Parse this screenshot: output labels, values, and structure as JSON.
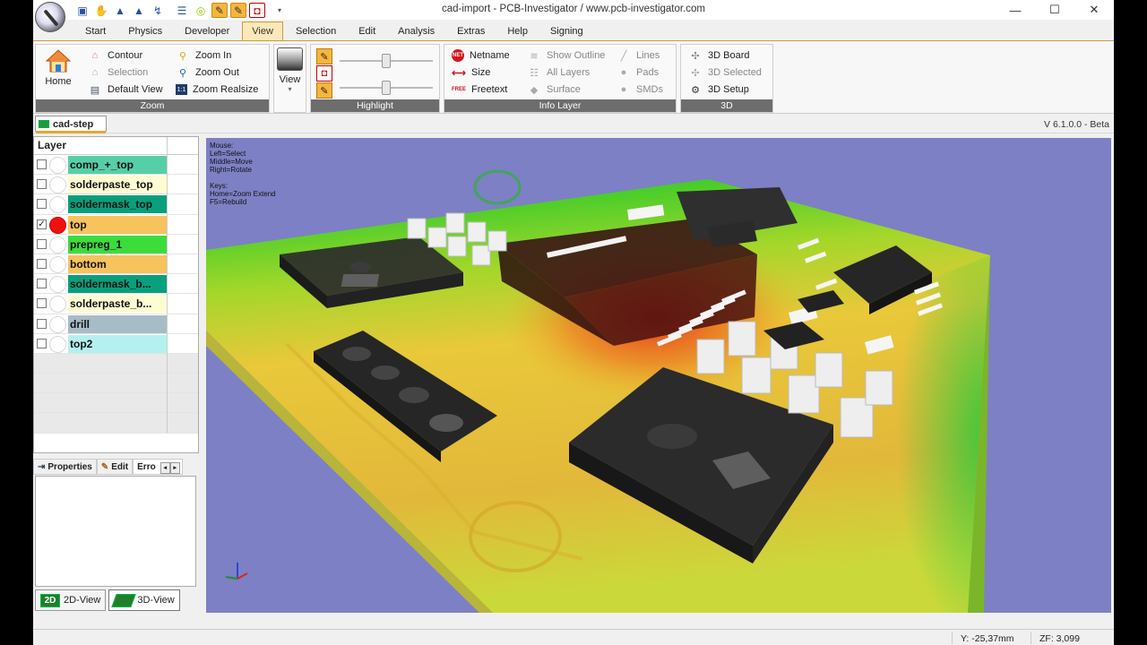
{
  "window": {
    "title": "cad-import - PCB-Investigator  /  www.pcb-investigator.com",
    "controls": [
      "—",
      "☐",
      "✕"
    ]
  },
  "quick_access": {
    "buttons": [
      "save-icon",
      "hand-icon",
      "tree-icon",
      "tree-select-icon",
      "route-icon",
      "layer-stack-icon",
      "circle-icon",
      "highlight-icon",
      "highlight2-icon",
      "frame-icon"
    ],
    "dropdown": "▾"
  },
  "tabs": [
    "Start",
    "Physics",
    "Developer",
    "View",
    "Selection",
    "Edit",
    "Analysis",
    "Extras",
    "Help",
    "Signing"
  ],
  "active_tab": "View",
  "ribbon": {
    "zoom": {
      "label": "Zoom",
      "home": "Home",
      "contour": "Contour",
      "selection": "Selection",
      "default_view": "Default View",
      "zoom_in": "Zoom In",
      "zoom_out": "Zoom Out",
      "zoom_realsize": "Zoom Realsize"
    },
    "view": {
      "label": "View",
      "dropdown": "▾"
    },
    "highlight": {
      "label": "Highlight",
      "slider1": 0.5,
      "slider2": 0.5
    },
    "info_layer": {
      "label": "Info Layer",
      "netname": "Netname",
      "size": "Size",
      "freetext": "Freetext",
      "show_outline": "Show Outline",
      "all_layers": "All Layers",
      "surface": "Surface",
      "lines": "Lines",
      "pads": "Pads",
      "smds": "SMDs",
      "net_badge": "NET",
      "freetext_badge": "FREE"
    },
    "three_d": {
      "label": "3D",
      "board": "3D Board",
      "selected": "3D Selected",
      "setup": "3D Setup"
    }
  },
  "document": {
    "tab": "cad-step",
    "version": "V 6.1.0.0 - Beta"
  },
  "layers": {
    "header": "Layer",
    "items": [
      {
        "name": "comp_+_top",
        "color": "#56cfa8",
        "checked": false,
        "active": false
      },
      {
        "name": "solderpaste_top",
        "color": "#fffbd2",
        "checked": false,
        "active": false
      },
      {
        "name": "soldermask_top",
        "color": "#08a07c",
        "checked": false,
        "active": false
      },
      {
        "name": "top",
        "color": "#f6c35c",
        "checked": true,
        "active": true
      },
      {
        "name": "prepreg_1",
        "color": "#3ddc3d",
        "checked": false,
        "active": false
      },
      {
        "name": "bottom",
        "color": "#f6c35c",
        "checked": false,
        "active": false
      },
      {
        "name": "soldermask_b...",
        "color": "#08a07c",
        "checked": false,
        "active": false
      },
      {
        "name": "solderpaste_b...",
        "color": "#fffbd2",
        "checked": false,
        "active": false
      },
      {
        "name": "drill",
        "color": "#a8bcc8",
        "checked": false,
        "active": false
      },
      {
        "name": "top2",
        "color": "#b4f0f0",
        "checked": false,
        "active": false
      }
    ]
  },
  "properties_tabs": {
    "properties": "Properties",
    "edit": "Edit",
    "errors": "Erro",
    "left": "◂",
    "right": "▸"
  },
  "view_tabs": {
    "two_d_badge": "2D",
    "two_d": "2D-View",
    "three_d": "3D-View"
  },
  "viewport_hints": {
    "mouse": "Mouse:",
    "left": "Left=Select",
    "middle": "Middle=Move",
    "right": "Right=Rotate",
    "keys": "Keys:",
    "home": "Home=Zoom Extend",
    "f5": "F5=Rebuild"
  },
  "status": {
    "y": "Y: -25,37mm",
    "zf": "ZF: 3,099"
  },
  "colors": {
    "accent": "#e8a531",
    "viewport_bg": "#7d80c4",
    "board_green": "#2ccf2f",
    "board_yellow": "#e9c83a",
    "board_red": "#e23a18",
    "component_dark": "#2b2b2b"
  }
}
